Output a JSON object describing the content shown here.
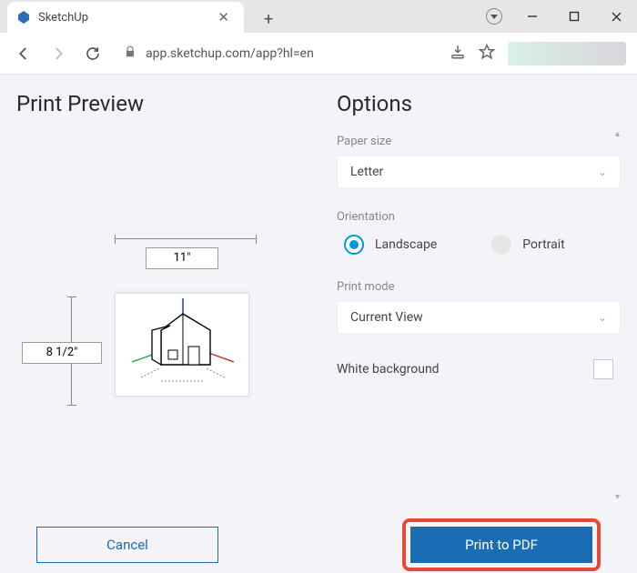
{
  "browser": {
    "tab_title": "SketchUp",
    "url": "app.sketchup.com/app?hl=en"
  },
  "left": {
    "title": "Print Preview",
    "width_label": "11\"",
    "height_label": "8 1/2\""
  },
  "right": {
    "title": "Options",
    "paper_size": {
      "label": "Paper size",
      "value": "Letter"
    },
    "orientation": {
      "label": "Orientation",
      "landscape": "Landscape",
      "portrait": "Portrait",
      "selected": "landscape"
    },
    "print_mode": {
      "label": "Print mode",
      "value": "Current View"
    },
    "white_bg": {
      "label": "White background",
      "checked": false
    }
  },
  "footer": {
    "cancel": "Cancel",
    "print": "Print to PDF"
  }
}
